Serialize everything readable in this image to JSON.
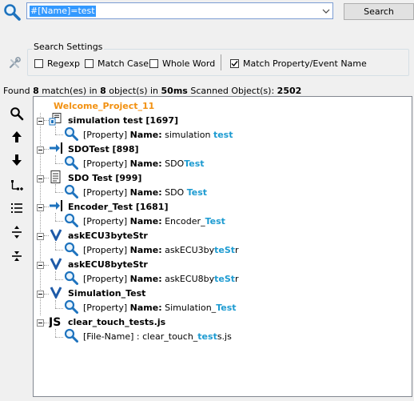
{
  "search": {
    "query": "#[Name]=test",
    "button_label": "Search"
  },
  "settings": {
    "title": "Search Settings",
    "regexp_label": "Regexp",
    "regexp_checked": false,
    "match_case_label": "Match Case",
    "match_case_checked": false,
    "whole_word_label": "Whole Word",
    "whole_word_checked": false,
    "match_property_label": "Match Property/Event Name",
    "match_property_checked": true
  },
  "status": {
    "prefix": "Found ",
    "matches": "8",
    "mid1": " match(es) in ",
    "objects": "8",
    "mid2": " object(s) in ",
    "time": "50ms",
    "mid3": " Scanned Object(s): ",
    "scanned": "2502"
  },
  "toolbar_icons": [
    "search-icon",
    "arrow-up-icon",
    "arrow-down-icon",
    "expand-tree-icon",
    "list-icon",
    "expand-all-icon",
    "collapse-all-icon"
  ],
  "tree": {
    "root": "Welcome_Project_11",
    "items": [
      {
        "icon": "simulation-icon",
        "name": "simulation test [1697]",
        "prefix": "[Property] ",
        "key": "Name:",
        "value_pre": " simulation ",
        "value_hl": "test",
        "value_post": ""
      },
      {
        "icon": "arrow-block-icon",
        "name": "SDOTest [898]",
        "prefix": "[Property] ",
        "key": "Name:",
        "value_pre": " SDO",
        "value_hl": "Test",
        "value_post": ""
      },
      {
        "icon": "document-icon",
        "name": "SDO Test [999]",
        "prefix": "[Property] ",
        "key": "Name:",
        "value_pre": " SDO ",
        "value_hl": "Test",
        "value_post": ""
      },
      {
        "icon": "arrow-block-icon",
        "name": "Encoder_Test [1681]",
        "prefix": "[Property] ",
        "key": "Name:",
        "value_pre": " Encoder_",
        "value_hl": "Test",
        "value_post": ""
      },
      {
        "icon": "variable-icon",
        "name": "askECU3byteStr",
        "prefix": "[Property] ",
        "key": "Name:",
        "value_pre": " askECU3by",
        "value_hl": "teSt",
        "value_post": "r"
      },
      {
        "icon": "variable-icon",
        "name": "askECU8byteStr",
        "prefix": "[Property] ",
        "key": "Name:",
        "value_pre": " askECU8by",
        "value_hl": "teSt",
        "value_post": "r"
      },
      {
        "icon": "variable-icon",
        "name": "Simulation_Test",
        "prefix": "[Property] ",
        "key": "Name:",
        "value_pre": " Simulation_",
        "value_hl": "Test",
        "value_post": ""
      },
      {
        "icon": "js-icon",
        "name": "clear_touch_tests.js",
        "prefix": "[File-Name] : ",
        "key": "",
        "value_pre": "clear_touch_",
        "value_hl": "test",
        "value_post": "s.js"
      }
    ]
  }
}
